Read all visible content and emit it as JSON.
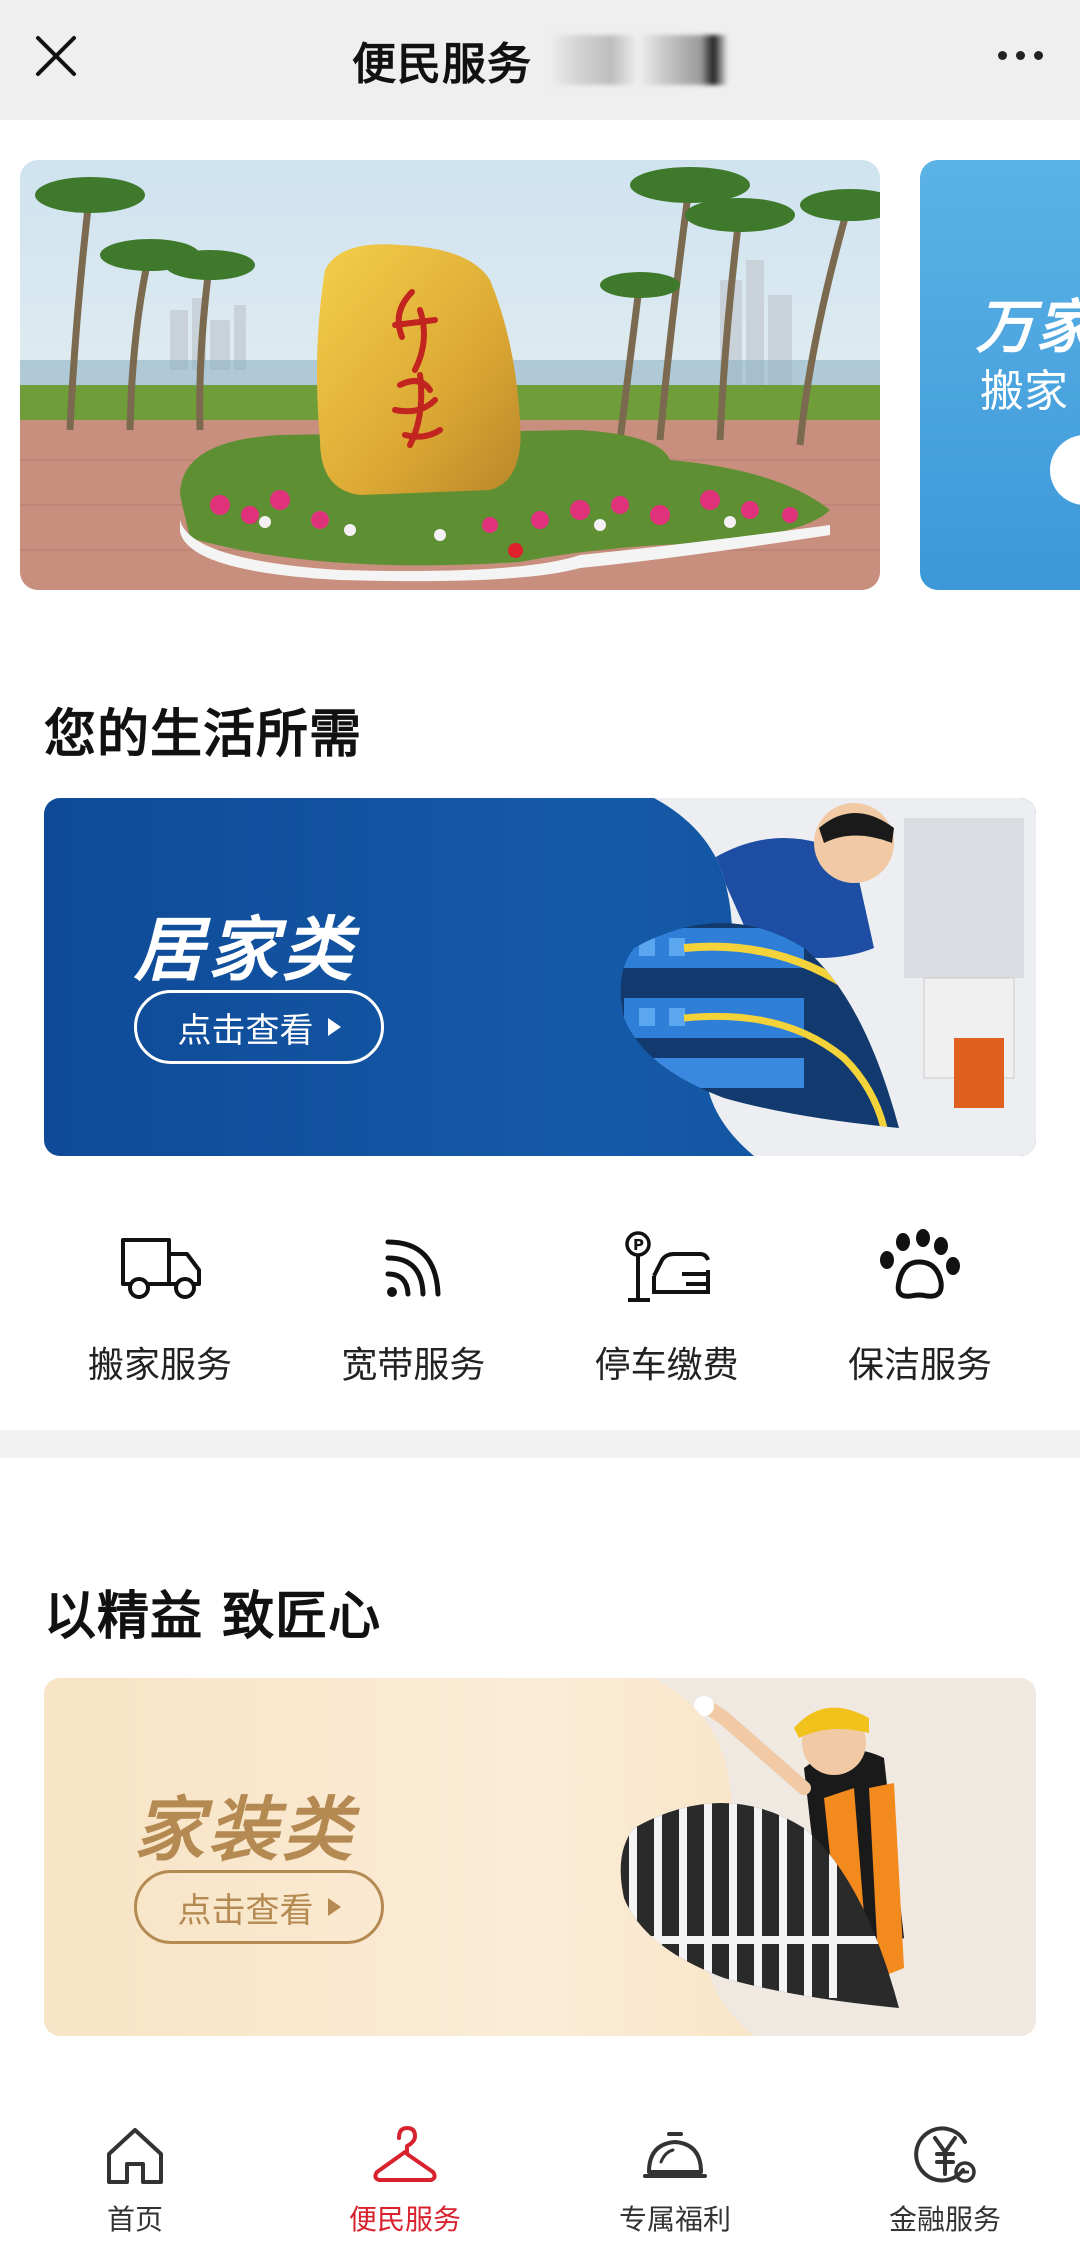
{
  "topbar": {
    "title": "便民服务"
  },
  "banner": {
    "next_card_title": "万家",
    "next_card_subtitle": "搬家"
  },
  "sections": {
    "life_title": "您的生活所需",
    "craft_title": "以精益 致匠心"
  },
  "cards": {
    "home": {
      "label": "居家类",
      "button": "点击查看"
    },
    "decor": {
      "label": "家装类",
      "button": "点击查看"
    }
  },
  "services": [
    {
      "label": "搬家服务",
      "icon": "truck-icon"
    },
    {
      "label": "宽带服务",
      "icon": "wifi-icon"
    },
    {
      "label": "停车缴费",
      "icon": "parking-car-icon"
    },
    {
      "label": "保洁服务",
      "icon": "paw-icon"
    }
  ],
  "bottom_nav": [
    {
      "label": "首页",
      "icon": "home-icon",
      "active": false
    },
    {
      "label": "便民服务",
      "icon": "hanger-icon",
      "active": true
    },
    {
      "label": "专属福利",
      "icon": "bell-icon",
      "active": false
    },
    {
      "label": "金融服务",
      "icon": "yuan-icon",
      "active": false
    }
  ],
  "colors": {
    "accent": "#d8232e",
    "home_card": "#155aa8",
    "decor_card": "#f8e4c6",
    "decor_text": "#b58a52"
  }
}
